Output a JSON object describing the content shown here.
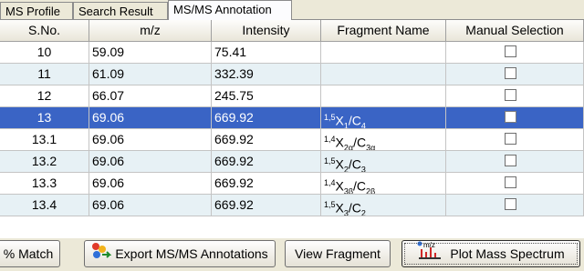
{
  "tabs": [
    {
      "label": "MS Profile"
    },
    {
      "label": "Search Result"
    },
    {
      "label": "MS/MS Annotation",
      "active": true
    }
  ],
  "table": {
    "headers": [
      "S.No.",
      "m/z",
      "Intensity",
      "Fragment Name",
      "Manual Selection"
    ],
    "rows": [
      {
        "sno": "10",
        "mz": "59.09",
        "intensity": "75.41",
        "fragment": {
          "pre": "",
          "sup": "",
          "main": "",
          "sub": "",
          "tail": "",
          "sub2": ""
        },
        "selected": false
      },
      {
        "sno": "11",
        "mz": "61.09",
        "intensity": "332.39",
        "fragment": {
          "pre": "",
          "sup": "",
          "main": "",
          "sub": "",
          "tail": "",
          "sub2": ""
        },
        "selected": false
      },
      {
        "sno": "12",
        "mz": "66.07",
        "intensity": "245.75",
        "fragment": {
          "pre": "",
          "sup": "",
          "main": "",
          "sub": "",
          "tail": "",
          "sub2": ""
        },
        "selected": false
      },
      {
        "sno": "13",
        "mz": "69.06",
        "intensity": "669.92",
        "fragment": {
          "sup": "1,5",
          "main": "X",
          "sub": "1",
          "tail": "/C",
          "sub2": "4"
        },
        "selected": true
      },
      {
        "sno": "13.1",
        "mz": "69.06",
        "intensity": "669.92",
        "fragment": {
          "sup": "1,4",
          "main": "X",
          "sub": "2α",
          "tail": "/C",
          "sub2": "3α"
        },
        "selected": false
      },
      {
        "sno": "13.2",
        "mz": "69.06",
        "intensity": "669.92",
        "fragment": {
          "sup": "1,5",
          "main": "X",
          "sub": "2",
          "tail": "/C",
          "sub2": "3"
        },
        "selected": false
      },
      {
        "sno": "13.3",
        "mz": "69.06",
        "intensity": "669.92",
        "fragment": {
          "sup": "1,4",
          "main": "X",
          "sub": "3β",
          "tail": "/C",
          "sub2": "2β"
        },
        "selected": false
      },
      {
        "sno": "13.4",
        "mz": "69.06",
        "intensity": "669.92",
        "fragment": {
          "sup": "1,5",
          "main": "X",
          "sub": "3",
          "tail": "/C",
          "sub2": "2"
        },
        "selected": false
      }
    ]
  },
  "buttons": {
    "match": "% Match",
    "export": "Export MS/MS Annotations",
    "view_fragment": "View Fragment",
    "plot": "Plot Mass Spectrum",
    "plot_icon_text": "m/z"
  },
  "colors": {
    "selected_row": "#3a64c5",
    "alt_row": "#e7f1f5"
  }
}
